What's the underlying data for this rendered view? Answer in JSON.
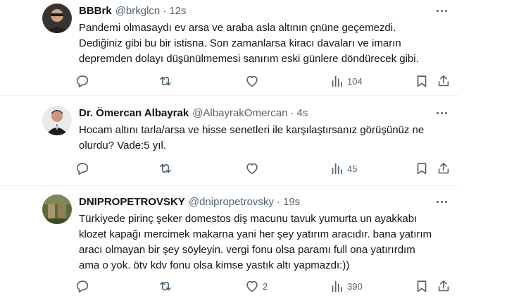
{
  "tweets": [
    {
      "name": "BBBrk",
      "handle": "@brkglcn",
      "time": "12s",
      "text": "Pandemi olmasaydı ev arsa ve araba asla altının çnüne geçemezdi.\nDediğiniz gibi bu bir istisna. Son zamanlarsa kiracı davaları ve imarın\ndepremden dolayı düşünülmemesi sanırım eski günlere döndürecek gibi.",
      "replies": "",
      "reposts": "",
      "likes": "",
      "views": "104"
    },
    {
      "name": "Dr. Ömercan Albayrak",
      "handle": "@AlbayrakOmercan",
      "time": "4s",
      "text": "Hocam altını tarla/arsa ve hisse senetleri ile karşılaştırsanız görüşünüz ne\nolurdu? Vade:5 yıl.",
      "replies": "",
      "reposts": "",
      "likes": "",
      "views": "45"
    },
    {
      "name": "DNIPROPETROVSKY",
      "handle": "@dnipropetrovsky",
      "time": "19s",
      "text": "Türkiyede pirinç şeker domestos diş macunu tavuk yumurta un ayakkabı\nklozet kapağı mercimek makarna yani her şey yatırım aracıdır. bana yatırım\naracı olmayan bir şey söyleyin. vergi fonu olsa paramı full ona yatırırdım\nama o yok. ötv kdv fonu olsa kimse yastık altı yapmazdı:))",
      "replies": "",
      "reposts": "",
      "likes": "2",
      "views": "390"
    }
  ],
  "dot": "·",
  "icons": [
    "more-icon",
    "reply-icon",
    "repost-icon",
    "like-icon",
    "views-icon",
    "bookmark-icon",
    "share-icon"
  ],
  "colors": {
    "text": "#0f1419",
    "secondary": "#536471",
    "divider": "#eff3f4"
  }
}
